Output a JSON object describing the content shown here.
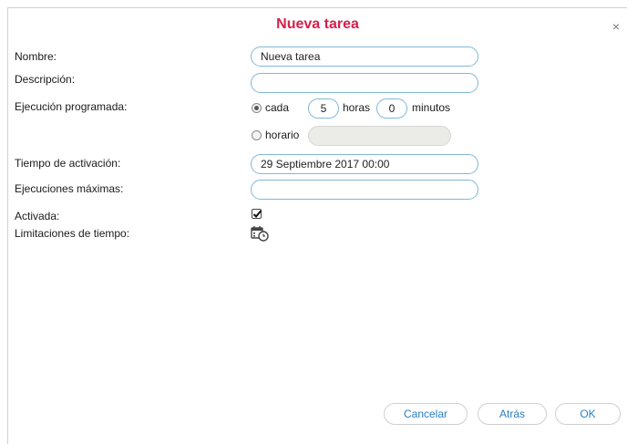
{
  "dialog": {
    "title": "Nueva tarea",
    "close": "×"
  },
  "labels": {
    "name": "Nombre:",
    "description": "Descripción:",
    "scheduled": "Ejecución programada:",
    "activation_time": "Tiempo de activación:",
    "max_runs": "Ejecuciones máximas:",
    "enabled": "Activada:",
    "time_limits": "Limitaciones de tiempo:"
  },
  "fields": {
    "name_value": "Nueva tarea",
    "description_value": "",
    "every_label": "cada",
    "hours_value": "5",
    "hours_label": "horas",
    "minutes_value": "0",
    "minutes_label": "minutos",
    "schedule_label": "horario",
    "schedule_value": "",
    "activation_value": "29 Septiembre 2017 00:00",
    "max_runs_value": "",
    "enabled_checked": true,
    "selected_mode": "cada"
  },
  "buttons": {
    "cancel": "Cancelar",
    "back": "Atrás",
    "ok": "OK"
  },
  "icons": {
    "close": "close-icon",
    "time_limits": "calendar-clock-icon",
    "check": "checkmark-icon"
  }
}
